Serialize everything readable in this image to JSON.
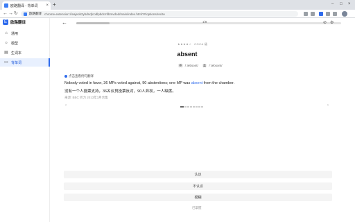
{
  "browser": {
    "tab_title": "欧路翻译 - 背单词",
    "url_chip": "欧路翻译",
    "url": "chrome-extension://eajeob2ybdnqfcodlpbdcmfbmvdod/main/index.html?#/options/recite"
  },
  "app": {
    "brand_name": "欧路翻译",
    "nav": [
      {
        "icon": "⌂",
        "label": "通用"
      },
      {
        "icon": "☼",
        "label": "模型"
      },
      {
        "icon": "▤",
        "label": "生词本"
      },
      {
        "icon": "▭",
        "label": "背单词"
      }
    ]
  },
  "header": {
    "progress_text": "1/8",
    "progress_fraction": 0.125
  },
  "card": {
    "stars": "★★★★☆",
    "star_label": "COCA 级",
    "word": "absent",
    "phon_uk_tag": "英",
    "phon_uk": "/ˈæbsənt/",
    "phon_us_tag": "美",
    "phon_us": "/ˈæbsənt/",
    "example_label": "点击查看例句翻译",
    "sentence_before": "Nobody voted in favor, 36 MPs voted against, 90 abstentions; one MP was ",
    "sentence_highlight": "absent",
    "sentence_after": " from the chamber.",
    "sentence_zh": "没有一个人投票支持，36名议员投票反对，90人弃权，一人缺席。",
    "source": "来源: BBC 听力 2013年3月合集"
  },
  "actions": {
    "know": "认识",
    "unknown": "不认识",
    "vague": "模糊",
    "mastered": "已掌握"
  }
}
